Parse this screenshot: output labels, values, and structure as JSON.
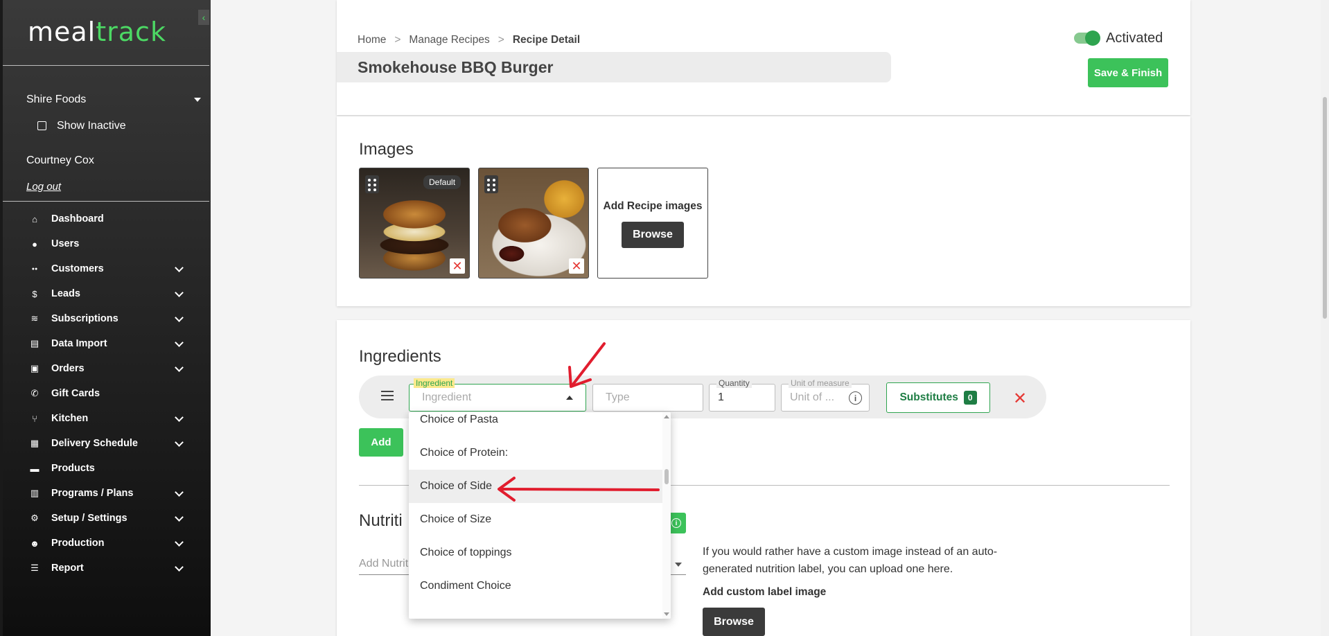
{
  "app": {
    "logo_meal": "meal",
    "logo_track": "track",
    "accent": "#4cd964"
  },
  "sidebar": {
    "account": "Shire Foods",
    "show_inactive": "Show Inactive",
    "user_name": "Courtney Cox",
    "logout": "Log out",
    "items": [
      {
        "label": "Dashboard",
        "icon": "home-icon",
        "expandable": false
      },
      {
        "label": "Users",
        "icon": "user-icon",
        "expandable": false
      },
      {
        "label": "Customers",
        "icon": "users-icon",
        "expandable": true
      },
      {
        "label": "Leads",
        "icon": "dollar-icon",
        "expandable": true
      },
      {
        "label": "Subscriptions",
        "icon": "layers-icon",
        "expandable": true
      },
      {
        "label": "Data Import",
        "icon": "file-icon",
        "expandable": true
      },
      {
        "label": "Orders",
        "icon": "bag-icon",
        "expandable": true
      },
      {
        "label": "Gift Cards",
        "icon": "phone-icon",
        "expandable": false
      },
      {
        "label": "Kitchen",
        "icon": "utensils-icon",
        "expandable": true
      },
      {
        "label": "Delivery Schedule",
        "icon": "calendar-icon",
        "expandable": true
      },
      {
        "label": "Products",
        "icon": "briefcase-icon",
        "expandable": false
      },
      {
        "label": "Programs / Plans",
        "icon": "clipboard-icon",
        "expandable": true
      },
      {
        "label": "Setup / Settings",
        "icon": "gear-icon",
        "expandable": true
      },
      {
        "label": "Production",
        "icon": "person-icon",
        "expandable": true
      },
      {
        "label": "Report",
        "icon": "list-check-icon",
        "expandable": true
      }
    ]
  },
  "header": {
    "breadcrumb": [
      "Home",
      "Manage Recipes",
      "Recipe Detail"
    ],
    "breadcrumb_sep": ">",
    "title": "Smokehouse BBQ Burger",
    "activated_label": "Activated",
    "save_label": "Save & Finish"
  },
  "images": {
    "title": "Images",
    "default_badge": "Default",
    "add_label": "Add Recipe images",
    "browse_label": "Browse"
  },
  "ingredients": {
    "title": "Ingredients",
    "ingredient_label": "Ingredient",
    "ingredient_placeholder": "Ingredient",
    "type_placeholder": "Type",
    "quantity_label": "Quantity",
    "quantity_value": "1",
    "uom_label": "Unit of measure",
    "uom_placeholder": "Unit of ...",
    "substitutes_label": "Substitutes",
    "substitutes_count": "0",
    "add_label": "Add",
    "dropdown_options": [
      "Choice of Pasta",
      "Choice of Protein:",
      "Choice of Side",
      "Choice of Size",
      "Choice of toppings",
      "Condiment Choice"
    ],
    "highlighted_option": "Choice of Side"
  },
  "nutrition": {
    "title_visible": "Nutriti",
    "add_placeholder": "Add Nutrit",
    "custom_text": "If you would rather have a custom image instead of an auto-generated nutrition label, you can upload one here.",
    "custom_label": "Add custom label image",
    "browse_label": "Browse"
  }
}
